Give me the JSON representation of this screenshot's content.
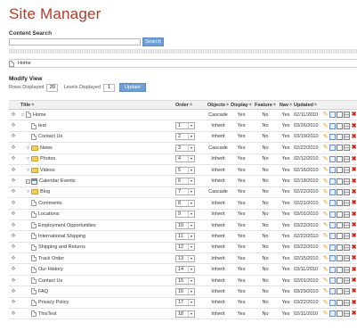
{
  "page": {
    "title": "Site Manager"
  },
  "search": {
    "label": "Content Search",
    "value": "",
    "button": "Search"
  },
  "breadcrumb": {
    "text": "Home"
  },
  "modify": {
    "title": "Modify View",
    "rows_label": "Rows Displayed",
    "rows_value": "20",
    "levels_label": "Levels Displayed",
    "levels_value": "1",
    "update_button": "Update"
  },
  "grid": {
    "headers": {
      "title": "Title",
      "order": "Order",
      "objects": "Objects",
      "display": "Display",
      "feature": "Feature",
      "nav": "Nav",
      "updated": "Updated"
    },
    "rows": [
      {
        "title": "Home",
        "indent": 0,
        "toggle": "expanded",
        "icon": "page",
        "order": "",
        "objects": "Cascade",
        "display": "Yes",
        "feature": "No",
        "nav": "Yes",
        "updated": "02/11/2010"
      },
      {
        "title": "test",
        "indent": 1,
        "toggle": "none",
        "icon": "page",
        "order": "1",
        "objects": "Inherit",
        "display": "Yes",
        "feature": "No",
        "nav": "Yes",
        "updated": "03/26/2010"
      },
      {
        "title": "Contact Us",
        "indent": 1,
        "toggle": "none",
        "icon": "page",
        "order": "2",
        "objects": "Inherit",
        "display": "Yes",
        "feature": "No",
        "nav": "Yes",
        "updated": "03/19/2010"
      },
      {
        "title": "News",
        "indent": 1,
        "toggle": "expanded",
        "icon": "folder",
        "order": "3",
        "objects": "Cascade",
        "display": "Yes",
        "feature": "No",
        "nav": "Yes",
        "updated": "02/22/2010"
      },
      {
        "title": "Photos",
        "indent": 1,
        "toggle": "expanded",
        "icon": "folder",
        "order": "4",
        "objects": "Inherit",
        "display": "Yes",
        "feature": "No",
        "nav": "Yes",
        "updated": "02/12/2010"
      },
      {
        "title": "Videos",
        "indent": 1,
        "toggle": "expanded",
        "icon": "folder",
        "order": "5",
        "objects": "Inherit",
        "display": "Yes",
        "feature": "No",
        "nav": "Yes",
        "updated": "02/16/2010"
      },
      {
        "title": "Calendar Events",
        "indent": 1,
        "toggle": "collapsed",
        "icon": "calendar",
        "order": "6",
        "objects": "Inherit",
        "display": "Yes",
        "feature": "No",
        "nav": "Yes",
        "updated": "02/18/2010"
      },
      {
        "title": "Blog",
        "indent": 1,
        "toggle": "expanded",
        "icon": "folder",
        "order": "7",
        "objects": "Cascade",
        "display": "Yes",
        "feature": "No",
        "nav": "Yes",
        "updated": "02/22/2010"
      },
      {
        "title": "Comments",
        "indent": 1,
        "toggle": "none",
        "icon": "page",
        "order": "8",
        "objects": "Inherit",
        "display": "Yes",
        "feature": "No",
        "nav": "Yes",
        "updated": "02/21/2010"
      },
      {
        "title": "Locations",
        "indent": 1,
        "toggle": "none",
        "icon": "page",
        "order": "9",
        "objects": "Inherit",
        "display": "Yes",
        "feature": "No",
        "nav": "Yes",
        "updated": "03/01/2010"
      },
      {
        "title": "Employment Opportunities",
        "indent": 1,
        "toggle": "none",
        "icon": "page",
        "order": "10",
        "objects": "Inherit",
        "display": "Yes",
        "feature": "No",
        "nav": "Yes",
        "updated": "03/22/2010"
      },
      {
        "title": "International Shipping",
        "indent": 1,
        "toggle": "none",
        "icon": "page",
        "order": "11",
        "objects": "Inherit",
        "display": "Yes",
        "feature": "No",
        "nav": "Yes",
        "updated": "02/22/2010"
      },
      {
        "title": "Shipping and Returns",
        "indent": 1,
        "toggle": "none",
        "icon": "page",
        "order": "12",
        "objects": "Inherit",
        "display": "Yes",
        "feature": "No",
        "nav": "Yes",
        "updated": "03/22/2010"
      },
      {
        "title": "Track Order",
        "indent": 1,
        "toggle": "none",
        "icon": "page",
        "order": "13",
        "objects": "Inherit",
        "display": "Yes",
        "feature": "No",
        "nav": "Yes",
        "updated": "02/15/2010"
      },
      {
        "title": "Our History",
        "indent": 1,
        "toggle": "none",
        "icon": "page",
        "order": "14",
        "objects": "Inherit",
        "display": "Yes",
        "feature": "No",
        "nav": "Yes",
        "updated": "03/11/2010"
      },
      {
        "title": "Contact Us",
        "indent": 1,
        "toggle": "none",
        "icon": "page",
        "order": "15",
        "objects": "Inherit",
        "display": "Yes",
        "feature": "No",
        "nav": "Yes",
        "updated": "02/01/2010"
      },
      {
        "title": "FAQ",
        "indent": 1,
        "toggle": "none",
        "icon": "page",
        "order": "16",
        "objects": "Inherit",
        "display": "Yes",
        "feature": "No",
        "nav": "Yes",
        "updated": "03/29/2010"
      },
      {
        "title": "Privacy Policy",
        "indent": 1,
        "toggle": "none",
        "icon": "page",
        "order": "17",
        "objects": "Inherit",
        "display": "Yes",
        "feature": "No",
        "nav": "Yes",
        "updated": "03/22/2010"
      },
      {
        "title": "ThisTest",
        "indent": 1,
        "toggle": "none",
        "icon": "page",
        "order": "18",
        "objects": "Inherit",
        "display": "Yes",
        "feature": "No",
        "nav": "Yes",
        "updated": "02/11/2010"
      }
    ],
    "action_icons": [
      "pencil-icon",
      "edit-icon",
      "page-edit-icon",
      "stack-icon",
      "delete-icon"
    ]
  },
  "colors": {
    "title": "#b33a2a",
    "button": "#6d9fd5",
    "folder": "#f0cf5a",
    "delete": "#cc2a1f"
  }
}
